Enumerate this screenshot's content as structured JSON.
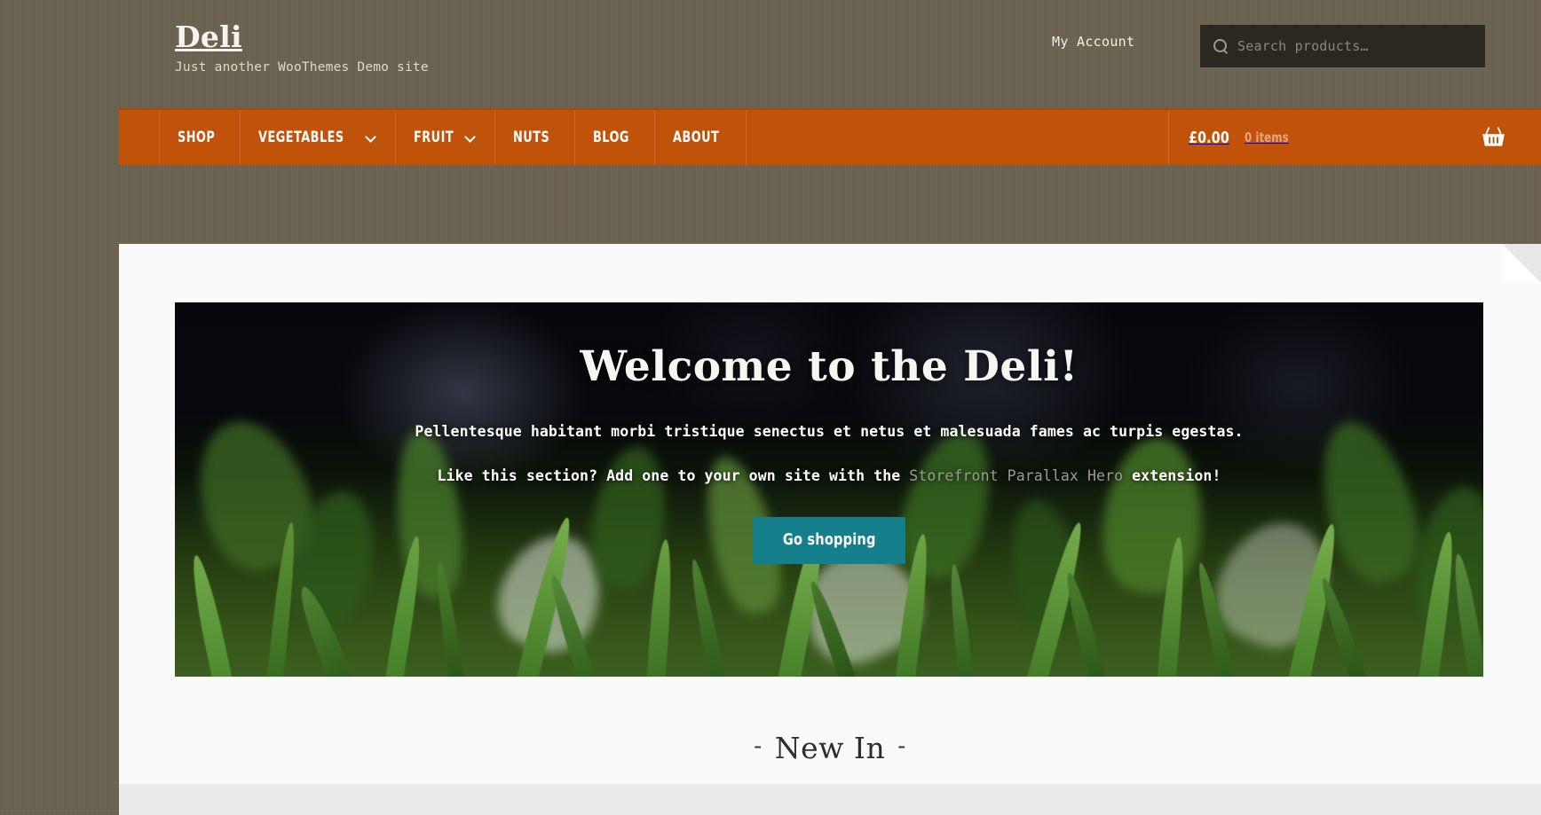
{
  "site": {
    "title": "Deli",
    "description": "Just another WooThemes Demo site"
  },
  "header": {
    "my_account_label": "My Account",
    "search": {
      "placeholder": "Search products…",
      "value": "",
      "icon": "search-icon"
    }
  },
  "nav": {
    "items": [
      {
        "label": "Shop",
        "has_dropdown": false
      },
      {
        "label": "Vegetables",
        "has_dropdown": true
      },
      {
        "label": "Fruit",
        "has_dropdown": true
      },
      {
        "label": "Nuts",
        "has_dropdown": false
      },
      {
        "label": "Blog",
        "has_dropdown": false
      },
      {
        "label": "About",
        "has_dropdown": false
      }
    ],
    "cart": {
      "amount": "£0.00",
      "count": "0 items",
      "icon": "shopping-basket-icon"
    },
    "accent_color": "#c1520a"
  },
  "hero": {
    "title": "Welcome to the Deli!",
    "paragraph_1": "Pellentesque habitant morbi tristique senectus et netus et malesuada fames ac turpis egestas.",
    "paragraph_2_before": "Like this section? Add one to your own site with the ",
    "paragraph_2_link": "Storefront Parallax Hero",
    "paragraph_2_after": " extension!",
    "button_label": "Go shopping",
    "button_color": "#157f8c"
  },
  "section": {
    "dash_left": "-",
    "title": "New In",
    "dash_right": "-"
  },
  "colors": {
    "page_background": "#6b6250",
    "content_background": "#fafafa",
    "nav_orange": "#c1520a",
    "teal": "#157f8c",
    "search_background": "#2b2721"
  }
}
